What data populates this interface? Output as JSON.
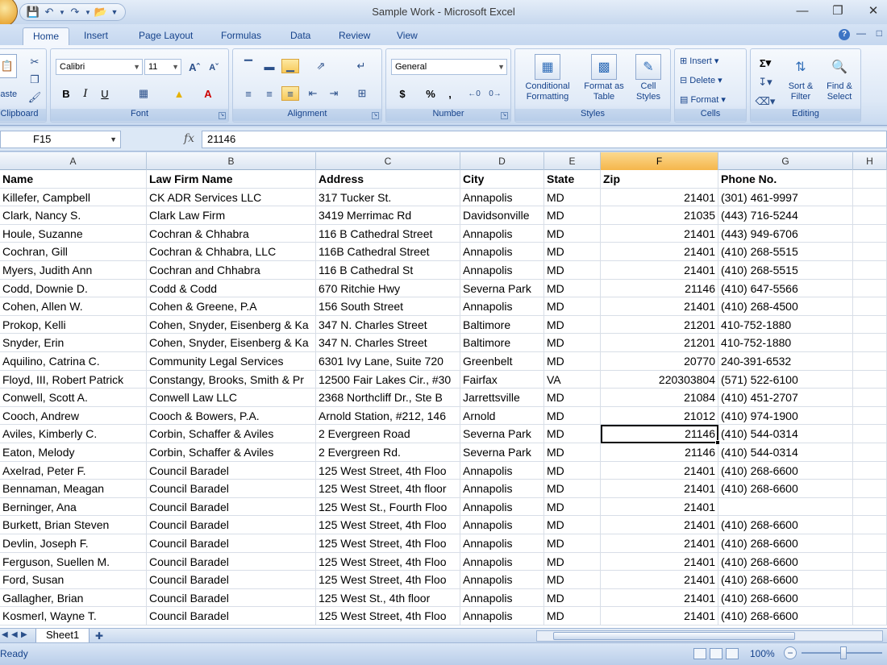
{
  "window": {
    "title": "Sample Work - Microsoft Excel"
  },
  "quick_access": [
    "save-icon",
    "undo-icon",
    "redo-icon",
    "open-icon"
  ],
  "tabs": [
    {
      "label": "Home",
      "active": true
    },
    {
      "label": "Insert"
    },
    {
      "label": "Page Layout"
    },
    {
      "label": "Formulas"
    },
    {
      "label": "Data"
    },
    {
      "label": "Review"
    },
    {
      "label": "View"
    }
  ],
  "ribbon": {
    "clipboard": {
      "label": "Clipboard",
      "paste": "Paste"
    },
    "font": {
      "label": "Font",
      "name": "Calibri",
      "size": "11",
      "bold": "B",
      "italic": "I",
      "underline": "U"
    },
    "alignment": {
      "label": "Alignment"
    },
    "number": {
      "label": "Number",
      "format": "General",
      "dollar": "$",
      "percent": "%",
      "comma": ","
    },
    "styles": {
      "label": "Styles",
      "conditional": "Conditional Formatting",
      "format_table": "Format as Table",
      "cell_styles": "Cell Styles"
    },
    "cells": {
      "label": "Cells",
      "insert": "Insert",
      "delete": "Delete",
      "format": "Format"
    },
    "editing": {
      "label": "Editing",
      "sigma": "Σ",
      "sort": "Sort & Filter",
      "find": "Find & Select"
    }
  },
  "formula_bar": {
    "name_box": "F15",
    "fx": "fx",
    "value": "21146"
  },
  "columns": [
    "A",
    "B",
    "C",
    "D",
    "E",
    "F",
    "G",
    "H"
  ],
  "selected_column": "F",
  "sheet": {
    "header": [
      "Name",
      "Law Firm Name",
      "Address",
      "City",
      "State",
      "Zip",
      "Phone No."
    ],
    "rows": [
      [
        "Killefer, Campbell",
        "CK ADR Services LLC",
        "317 Tucker St.",
        "Annapolis",
        "MD",
        "21401",
        "(301) 461-9997"
      ],
      [
        "Clark, Nancy S.",
        "Clark Law Firm",
        "3419 Merrimac Rd",
        "Davidsonville",
        "MD",
        "21035",
        "(443) 716-5244"
      ],
      [
        "Houle, Suzanne",
        "Cochran & Chhabra",
        "116 B Cathedral Street",
        "Annapolis",
        "MD",
        "21401",
        "(443) 949-6706"
      ],
      [
        "Cochran, Gill",
        "Cochran & Chhabra, LLC",
        "116B Cathedral Street",
        "Annapolis",
        "MD",
        "21401",
        "(410) 268-5515"
      ],
      [
        "Myers, Judith Ann",
        "Cochran and Chhabra",
        "116 B Cathedral St",
        "Annapolis",
        "MD",
        "21401",
        "(410) 268-5515"
      ],
      [
        "Codd, Downie D.",
        "Codd & Codd",
        "670 Ritchie Hwy",
        "Severna Park",
        "MD",
        "21146",
        "(410) 647-5566"
      ],
      [
        "Cohen, Allen W.",
        "Cohen & Greene, P.A",
        "156 South Street",
        "Annapolis",
        "MD",
        "21401",
        "(410) 268-4500"
      ],
      [
        "Prokop, Kelli",
        "Cohen, Snyder, Eisenberg & Ka",
        "347 N. Charles Street",
        "Baltimore",
        "MD",
        "21201",
        "410-752-1880"
      ],
      [
        "Snyder, Erin",
        "Cohen, Snyder, Eisenberg & Ka",
        "347 N. Charles Street",
        "Baltimore",
        "MD",
        "21201",
        "410-752-1880"
      ],
      [
        "Aquilino, Catrina C.",
        "Community Legal Services",
        "6301 Ivy Lane, Suite 720",
        "Greenbelt",
        "MD",
        "20770",
        "240-391-6532"
      ],
      [
        "Floyd, III, Robert Patrick",
        "Constangy, Brooks, Smith & Pr",
        "12500 Fair Lakes Cir., #30",
        "Fairfax",
        "VA",
        "220303804",
        "(571) 522-6100"
      ],
      [
        "Conwell, Scott A.",
        "Conwell Law LLC",
        "2368 Northcliff Dr., Ste B",
        "Jarrettsville",
        "MD",
        "21084",
        "(410) 451-2707"
      ],
      [
        "Cooch, Andrew",
        "Cooch & Bowers, P.A.",
        "Arnold Station, #212, 146",
        "Arnold",
        "MD",
        "21012",
        " (410) 974-1900"
      ],
      [
        "Aviles, Kimberly C.",
        "Corbin, Schaffer & Aviles",
        "2 Evergreen Road",
        "Severna Park",
        "MD",
        "21146",
        "(410) 544-0314"
      ],
      [
        "Eaton, Melody",
        "Corbin, Schaffer & Aviles",
        "2 Evergreen Rd.",
        "Severna Park",
        "MD",
        "21146",
        "(410) 544-0314"
      ],
      [
        "Axelrad, Peter F.",
        "Council Baradel",
        "125 West Street, 4th Floo",
        "Annapolis",
        "MD",
        "21401",
        "(410) 268-6600"
      ],
      [
        "Bennaman, Meagan",
        "Council Baradel",
        "125 West Street, 4th floor",
        "Annapolis",
        "MD",
        "21401",
        "(410) 268-6600"
      ],
      [
        "Berninger, Ana",
        "Council Baradel",
        "125 West St., Fourth Floo",
        "Annapolis",
        "MD",
        "21401",
        ""
      ],
      [
        "Burkett, Brian Steven",
        "Council Baradel",
        "125 West Street, 4th Floo",
        "Annapolis",
        "MD",
        "21401",
        "(410) 268-6600"
      ],
      [
        "Devlin, Joseph F.",
        "Council Baradel",
        "125 West Street, 4th Floo",
        "Annapolis",
        "MD",
        "21401",
        " (410) 268-6600"
      ],
      [
        "Ferguson, Suellen M.",
        "Council Baradel",
        "125 West Street, 4th Floo",
        "Annapolis",
        "MD",
        "21401",
        "(410) 268-6600"
      ],
      [
        "Ford, Susan",
        "Council Baradel",
        "125 West Street, 4th Floo",
        "Annapolis",
        "MD",
        "21401",
        "(410) 268-6600"
      ],
      [
        "Gallagher, Brian",
        "Council Baradel",
        "125 West St., 4th floor",
        "Annapolis",
        "MD",
        "21401",
        "(410) 268-6600"
      ],
      [
        "Kosmerl, Wayne T.",
        "Council Baradel",
        "125 West Street, 4th Floo",
        "Annapolis",
        "MD",
        "21401",
        "(410) 268-6600"
      ]
    ],
    "active_cell": {
      "row": 13,
      "col": 5
    }
  },
  "sheet_tabs": {
    "name": "Sheet1"
  },
  "status": {
    "text": "Ready",
    "zoom": "100%"
  }
}
